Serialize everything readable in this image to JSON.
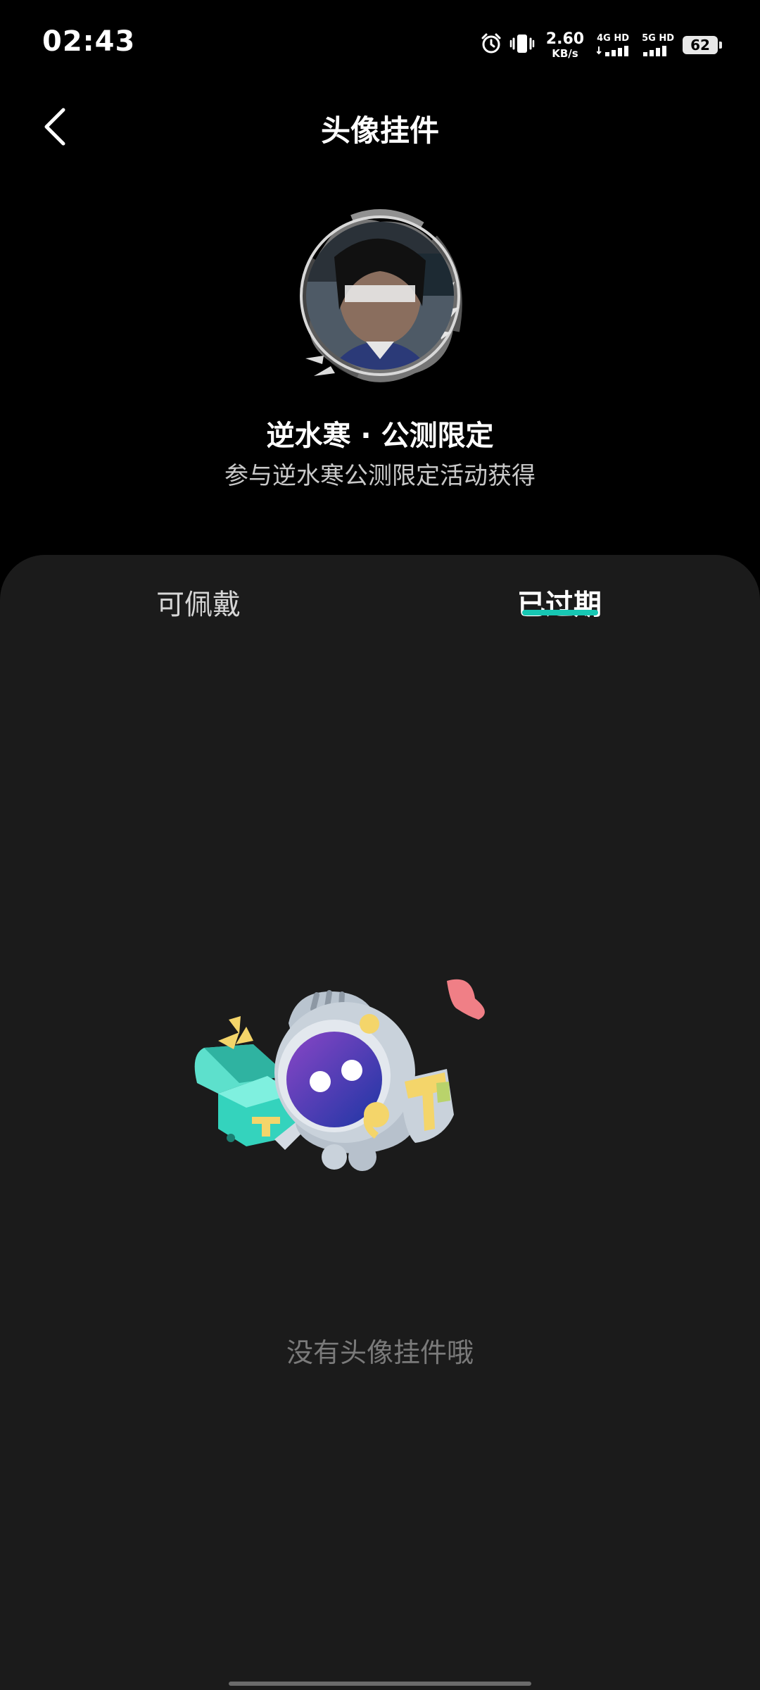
{
  "status": {
    "time": "02:43",
    "net_speed_value": "2.60",
    "net_speed_unit": "KB/s",
    "sim1_label": "4G HD",
    "sim2_label": "5G HD",
    "battery": "62",
    "icons": [
      "alarm-icon",
      "vibrate-icon",
      "signal-icon",
      "battery-icon"
    ]
  },
  "nav": {
    "title": "头像挂件",
    "back_icon": "chevron-left-icon"
  },
  "pendant": {
    "name": "逆水寒 · 公测限定",
    "description": "参与逆水寒公测限定活动获得"
  },
  "tabs": [
    {
      "label": "可佩戴",
      "selected": false
    },
    {
      "label": "已过期",
      "selected": true
    }
  ],
  "empty_state": {
    "text": "没有头像挂件哦",
    "illustration": "knight-with-treasure-chest"
  },
  "colors": {
    "background": "#000000",
    "sheet": "#1b1b1b",
    "accent": "#17c7b3"
  }
}
